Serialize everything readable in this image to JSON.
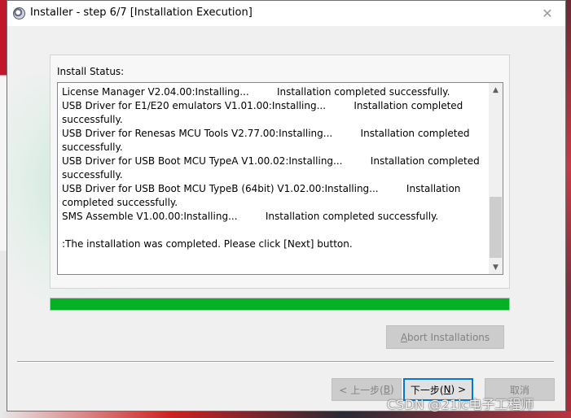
{
  "window": {
    "title": "Installer - step 6/7 [Installation Execution]",
    "close_glyph": "✕"
  },
  "status": {
    "label": "Install Status:",
    "lines": [
      "License Manager V2.04.00:Installing...         Installation completed successfully.",
      "USB Driver for E1/E20 emulators V1.01.00:Installing...         Installation completed successfully.",
      "USB Driver for Renesas MCU Tools V2.77.00:Installing...         Installation completed successfully.",
      "USB Driver for USB Boot MCU TypeA V1.00.02:Installing...         Installation completed successfully.",
      "USB Driver for USB Boot MCU TypeB (64bit) V1.02.00:Installing...         Installation completed successfully.",
      "SMS Assemble V1.00.00:Installing...         Installation completed successfully.",
      "",
      ":The installation was completed. Please click [Next] button."
    ]
  },
  "progress": {
    "value": 1.0,
    "color": "#06b025"
  },
  "buttons": {
    "abort": {
      "underline": "A",
      "rest": "bort Installations"
    },
    "back": {
      "pre": "< 上一步(",
      "key": "B",
      "post": ")"
    },
    "next": {
      "pre": "下一步(",
      "key": "N",
      "post": ") >"
    },
    "cancel": "取消"
  },
  "watermark_text": "CSDN @21ic电子工程师"
}
